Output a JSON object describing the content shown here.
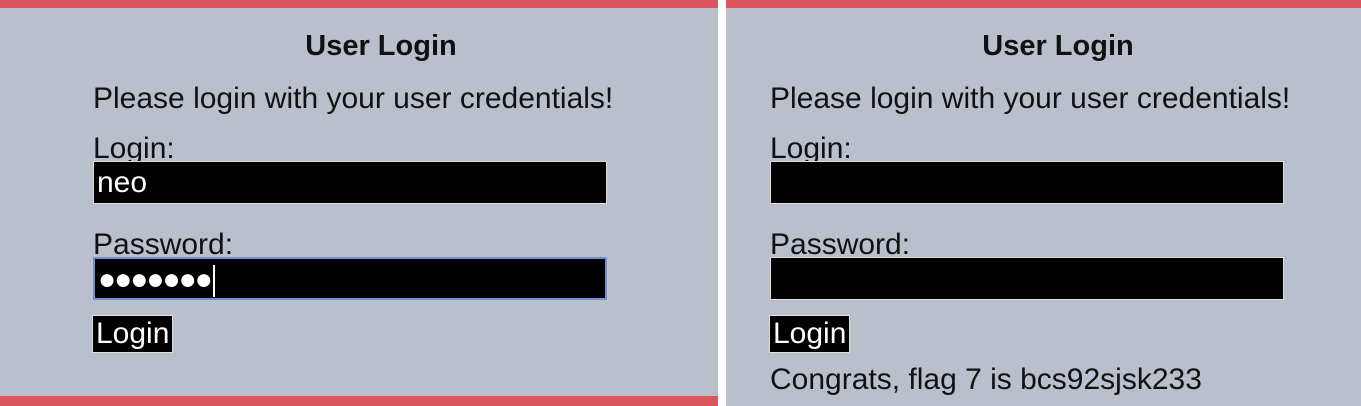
{
  "left": {
    "title": "User Login",
    "intro": "Please login with your user credentials!",
    "login_label": "Login:",
    "login_value": "neo",
    "password_label": "Password:",
    "password_masked": "●●●●●●●",
    "button": "Login"
  },
  "right": {
    "title": "User Login",
    "intro": "Please login with your user credentials!",
    "login_label": "Login:",
    "login_value": "",
    "password_label": "Password:",
    "button": "Login",
    "message": "Congrats, flag 7 is bcs92sjsk233"
  }
}
